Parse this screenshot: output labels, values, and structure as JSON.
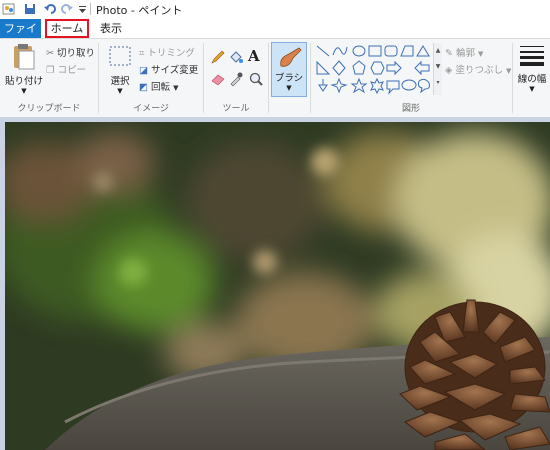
{
  "window": {
    "title": "Photo - ペイント"
  },
  "qat": {
    "icons": [
      "paint-app-icon",
      "save-icon",
      "undo-icon",
      "redo-icon",
      "customize-qat-icon"
    ]
  },
  "tabs": {
    "file": "ファイル",
    "home": "ホーム",
    "view": "表示"
  },
  "clipboard": {
    "paste": "貼り付け",
    "cut": "切り取り",
    "copy": "コピー",
    "label": "クリップボード"
  },
  "image": {
    "select": "選択",
    "crop": "トリミング",
    "resize": "サイズ変更",
    "rotate": "回転",
    "label": "イメージ"
  },
  "tools": {
    "label": "ツール"
  },
  "brush": {
    "label": "ブラシ"
  },
  "shapes": {
    "outline": "輪郭",
    "fill": "塗りつぶし",
    "label": "図形"
  },
  "size": {
    "label": "線の幅"
  },
  "colors": {
    "accent": "#1979ca",
    "highlight": "#e81123",
    "canvas_bg": "#c9d3e3"
  }
}
